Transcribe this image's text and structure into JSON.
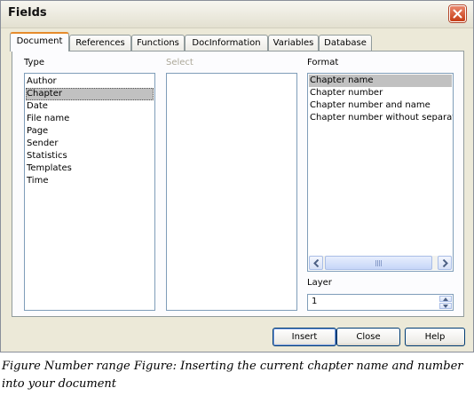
{
  "window": {
    "title": "Fields"
  },
  "tabs": [
    {
      "label": "Document",
      "active": true
    },
    {
      "label": "References"
    },
    {
      "label": "Functions"
    },
    {
      "label": "DocInformation"
    },
    {
      "label": "Variables"
    },
    {
      "label": "Database"
    }
  ],
  "type_list": {
    "label": "Type",
    "items": [
      "Author",
      "Chapter",
      "Date",
      "File name",
      "Page",
      "Sender",
      "Statistics",
      "Templates",
      "Time"
    ],
    "selected": "Chapter"
  },
  "select_list": {
    "label": "Select",
    "items": []
  },
  "format_list": {
    "label": "Format",
    "items": [
      "Chapter name",
      "Chapter number",
      "Chapter number and name",
      "Chapter number without separator"
    ],
    "selected": "Chapter name"
  },
  "layer": {
    "label": "Layer",
    "value": "1"
  },
  "buttons": {
    "insert": "Insert",
    "close": "Close",
    "help": "Help"
  },
  "caption": "Figure Number range Figure: Inserting the current chapter name and number into your document",
  "icons": {
    "close": "close-icon",
    "scroll_left": "arrow-left-icon",
    "scroll_right": "arrow-right-icon",
    "spin_up": "spin-up-icon",
    "spin_down": "spin-down-icon"
  },
  "colors": {
    "dialog_bg": "#ece9d8",
    "selection_bg": "#c1c1c1",
    "active_tab_accent": "#e68b2c",
    "close_button": "#c63d17"
  }
}
